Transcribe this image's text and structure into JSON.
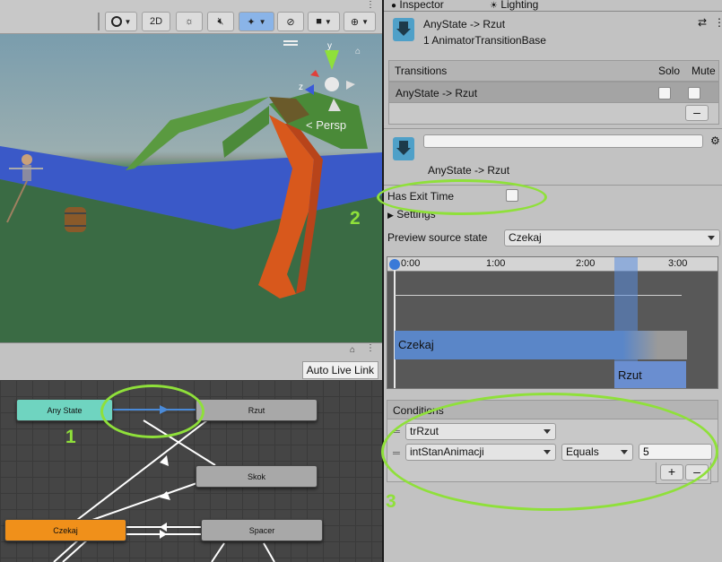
{
  "scene": {
    "toolbar": {
      "shading_label": "",
      "mode_2d_label": "2D"
    },
    "persp_label": "< Persp",
    "gizmo_y_label": "y",
    "gizmo_z_label": "z",
    "auto_live_link_label": "Auto Live Link"
  },
  "animator": {
    "states": [
      {
        "id": "any-state",
        "label": "Any State",
        "color": "#6fd4c0"
      },
      {
        "id": "rzut",
        "label": "Rzut",
        "color": "#a8a8a8"
      },
      {
        "id": "skok",
        "label": "Skok",
        "color": "#a8a8a8"
      },
      {
        "id": "czekaj",
        "label": "Czekaj",
        "color": "#f0901a"
      },
      {
        "id": "spacer",
        "label": "Spacer",
        "color": "#a8a8a8"
      }
    ]
  },
  "inspector": {
    "tabs": {
      "inspector_label": "Inspector",
      "lighting_label": "Lighting"
    },
    "header_title": "AnyState -> Rzut",
    "header_subtitle": "1 AnimatorTransitionBase",
    "transitions": {
      "header_label": "Transitions",
      "solo_label": "Solo",
      "mute_label": "Mute",
      "item_label": "AnyState -> Rzut",
      "remove_label": "–"
    },
    "transition_name_value": "",
    "transition_caption": "AnyState -> Rzut",
    "has_exit_time_label": "Has Exit Time",
    "settings_label": "Settings",
    "preview_source_label": "Preview source state",
    "preview_source_value": "Czekaj",
    "timeline": {
      "ticks": [
        "0:00",
        "1:00",
        "2:00",
        "3:00"
      ],
      "bar_czekaj": "Czekaj",
      "bar_rzut": "Rzut"
    },
    "conditions": {
      "header_label": "Conditions",
      "rows": [
        {
          "param": "trRzut",
          "op": "",
          "value": ""
        },
        {
          "param": "intStanAnimacji",
          "op": "Equals",
          "value": "5"
        }
      ],
      "add_label": "+",
      "remove_label": "–"
    }
  },
  "annotations": {
    "n1": "1",
    "n2": "2",
    "n3": "3",
    "ring_color": "#8fe03a"
  }
}
